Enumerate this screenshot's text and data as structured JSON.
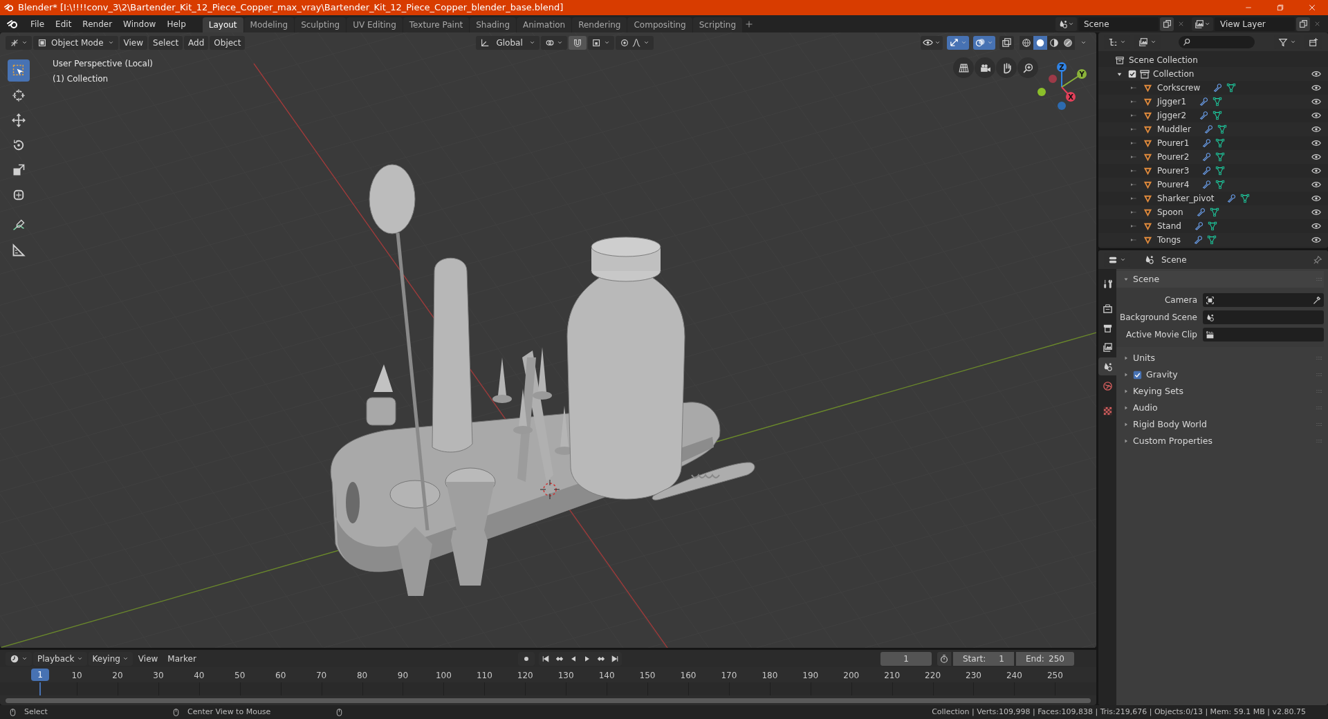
{
  "title_bar": {
    "title": "Blender* [I:\\!!!!conv_3\\2\\Bartender_Kit_12_Piece_Copper_max_vray\\Bartender_Kit_12_Piece_Copper_blender_base.blend]"
  },
  "menu": [
    "File",
    "Edit",
    "Render",
    "Window",
    "Help"
  ],
  "workspaces": [
    {
      "label": "Layout",
      "selected": true
    },
    {
      "label": "Modeling",
      "selected": false
    },
    {
      "label": "Sculpting",
      "selected": false
    },
    {
      "label": "UV Editing",
      "selected": false
    },
    {
      "label": "Texture Paint",
      "selected": false
    },
    {
      "label": "Shading",
      "selected": false
    },
    {
      "label": "Animation",
      "selected": false
    },
    {
      "label": "Rendering",
      "selected": false
    },
    {
      "label": "Compositing",
      "selected": false
    },
    {
      "label": "Scripting",
      "selected": false
    }
  ],
  "scene_selector": {
    "value": "Scene"
  },
  "view_layer_selector": {
    "value": "View Layer"
  },
  "viewport_header": {
    "mode": "Object Mode",
    "menus": [
      "View",
      "Select",
      "Add",
      "Object"
    ],
    "orientation": "Global",
    "toggles": [
      {
        "selected": false
      },
      {
        "selected": true
      },
      {
        "selected": true
      },
      {
        "selected": false
      }
    ],
    "shading": [
      {
        "selected": false
      },
      {
        "selected": true
      },
      {
        "selected": false
      },
      {
        "selected": false
      }
    ]
  },
  "viewport": {
    "overlay_text": [
      "User Perspective (Local)",
      "(1) Collection"
    ],
    "tools": [
      {
        "selected": true
      },
      {
        "selected": false
      },
      {
        "selected": false
      },
      {
        "selected": false
      },
      {
        "selected": false
      },
      {
        "selected": false
      },
      {
        "selected": false
      },
      {
        "selected": false
      }
    ],
    "gizmo_axes": [
      "Z",
      "Y",
      "X"
    ]
  },
  "outliner": {
    "root": "Scene Collection",
    "collection": {
      "label": "Collection",
      "checked": true,
      "expanded": true,
      "children": [
        {
          "label": "Corkscrew"
        },
        {
          "label": "Jigger1"
        },
        {
          "label": "Jigger2"
        },
        {
          "label": "Muddler"
        },
        {
          "label": "Pourer1"
        },
        {
          "label": "Pourer2"
        },
        {
          "label": "Pourer3"
        },
        {
          "label": "Pourer4"
        },
        {
          "label": "Sharker_pivot"
        },
        {
          "label": "Spoon"
        },
        {
          "label": "Stand"
        },
        {
          "label": "Tongs"
        }
      ]
    }
  },
  "properties": {
    "title": "Scene",
    "tabs": [
      {
        "selected": false
      },
      {
        "selected": false
      },
      {
        "selected": false
      },
      {
        "selected": false
      },
      {
        "selected": true
      },
      {
        "selected": false
      },
      {
        "selected": false
      }
    ],
    "panel": {
      "title": "Scene",
      "expanded": true,
      "fields": [
        {
          "label": "Camera"
        },
        {
          "label": "Background Scene"
        },
        {
          "label": "Active Movie Clip"
        }
      ]
    },
    "sections": [
      {
        "label": "Units",
        "kind": "plain",
        "expanded": false
      },
      {
        "label": "Gravity",
        "kind": "checkbox",
        "checked": true,
        "expanded": false
      },
      {
        "label": "Keying Sets",
        "kind": "plain",
        "expanded": false
      },
      {
        "label": "Audio",
        "kind": "plain",
        "expanded": false
      },
      {
        "label": "Rigid Body World",
        "kind": "plain",
        "expanded": false
      },
      {
        "label": "Custom Properties",
        "kind": "plain",
        "expanded": false
      }
    ]
  },
  "timeline": {
    "menus": [
      "Playback",
      "Keying",
      "View",
      "Marker"
    ],
    "current_frame": "1",
    "start_label": "Start:",
    "start": "1",
    "end_label": "End:",
    "end": "250",
    "ruler": [
      "1",
      "10",
      "20",
      "30",
      "40",
      "50",
      "60",
      "70",
      "80",
      "90",
      "100",
      "110",
      "120",
      "130",
      "140",
      "150",
      "160",
      "170",
      "180",
      "190",
      "200",
      "210",
      "220",
      "230",
      "240",
      "250"
    ]
  },
  "status_bar": {
    "hints": [
      "Select",
      "Center View to Mouse"
    ],
    "stats": "Collection | Verts:109,998 | Faces:109,838 | Tris:219,676 | Objects:0/13 | Mem: 59.1 MB | v2.80.75"
  }
}
